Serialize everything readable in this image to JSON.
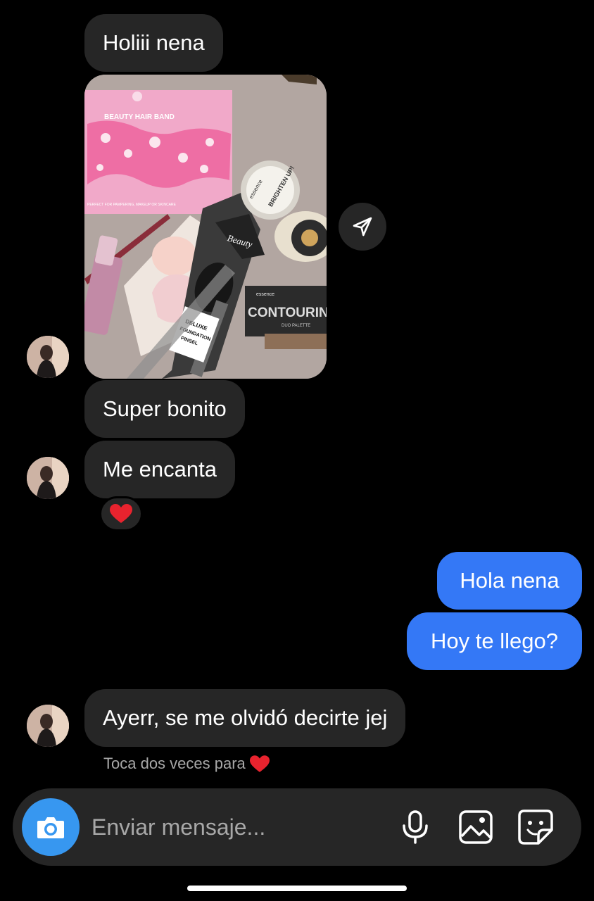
{
  "messages": {
    "m1": "Holiii nena",
    "m2": "Super bonito",
    "m3": "Me encanta",
    "m4": "Hola nena",
    "m5": "Hoy te llego?",
    "m6": "Ayerr, se me olvidó decirte jej"
  },
  "photo": {
    "band_title": "BEAUTY HAIR BAND",
    "band_caption": "PERFECT FOR PAMPERING, MAKEUP OR SKINCARE",
    "brand": "essence",
    "brighten": "BRIGHTEN UP!",
    "beauty": "Beauty",
    "contour": "CONTOURING",
    "contour_sub": "DUO PALETTE",
    "brush_label_1": "DELUXE",
    "brush_label_2": "FOUNDATION",
    "brush_label_3": "PINSEL"
  },
  "reaction": {
    "emoji": "❤️"
  },
  "hint": {
    "text": "Toca dos veces para",
    "emoji": "❤️"
  },
  "composer": {
    "placeholder": "Enviar mensaje..."
  },
  "icons": {
    "share": "send-icon",
    "camera": "camera-icon",
    "mic": "microphone-icon",
    "gallery": "gallery-icon",
    "sticker": "sticker-icon"
  },
  "colors": {
    "background": "#000000",
    "incoming_bubble": "#262626",
    "outgoing_bubble": "#3478f6",
    "camera_button": "#3797f0",
    "hint_text": "#a8a8a8"
  }
}
